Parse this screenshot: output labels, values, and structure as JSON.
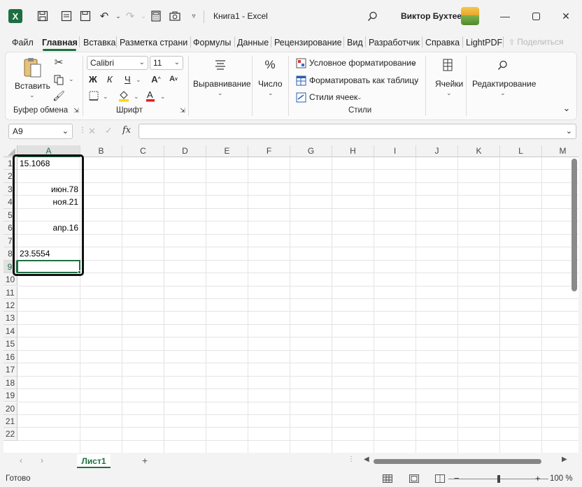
{
  "window": {
    "title": "Книга1  -  Excel",
    "user": "Виктор Бухтеев"
  },
  "tabs": [
    "Файл",
    "Главная",
    "Вставка",
    "Разметка страниц",
    "Формулы",
    "Данные",
    "Рецензирование",
    "Вид",
    "Разработчик",
    "Справка",
    "LightPDF"
  ],
  "share_label": "Поделиться",
  "ribbon": {
    "clipboard": {
      "paste_label": "Вставить",
      "group_label": "Буфер обмена"
    },
    "font": {
      "name": "Calibri",
      "size": "11",
      "group_label": "Шрифт",
      "bold": "Ж",
      "italic": "К",
      "underline": "Ч"
    },
    "alignment": {
      "label": "Выравнивание"
    },
    "number": {
      "label": "Число"
    },
    "styles": {
      "conditional": "Условное форматирование",
      "format_table": "Форматировать как таблицу",
      "cell_styles": "Стили ячеек",
      "group_label": "Стили"
    },
    "cells": {
      "label": "Ячейки"
    },
    "editing": {
      "label": "Редактирование"
    }
  },
  "formula_bar": {
    "name_box": "A9",
    "fx": "fx",
    "value": ""
  },
  "columns": [
    "A",
    "B",
    "C",
    "D",
    "E",
    "F",
    "G",
    "H",
    "I",
    "J",
    "K",
    "L",
    "M"
  ],
  "rows": [
    "1",
    "2",
    "3",
    "4",
    "5",
    "6",
    "7",
    "8",
    "9",
    "10",
    "11",
    "12",
    "13",
    "14",
    "15",
    "16",
    "17",
    "18",
    "19",
    "20",
    "21",
    "22"
  ],
  "cells": {
    "A1": "15.1068",
    "A3": "июн.78",
    "A4": "ноя.21",
    "A6": "апр.16",
    "A8": "23.5554"
  },
  "sheets": {
    "active": "Лист1",
    "add": "+"
  },
  "status": {
    "text": "Готово",
    "zoom": "100 %",
    "zoom_minus": "−",
    "zoom_plus": "+"
  }
}
